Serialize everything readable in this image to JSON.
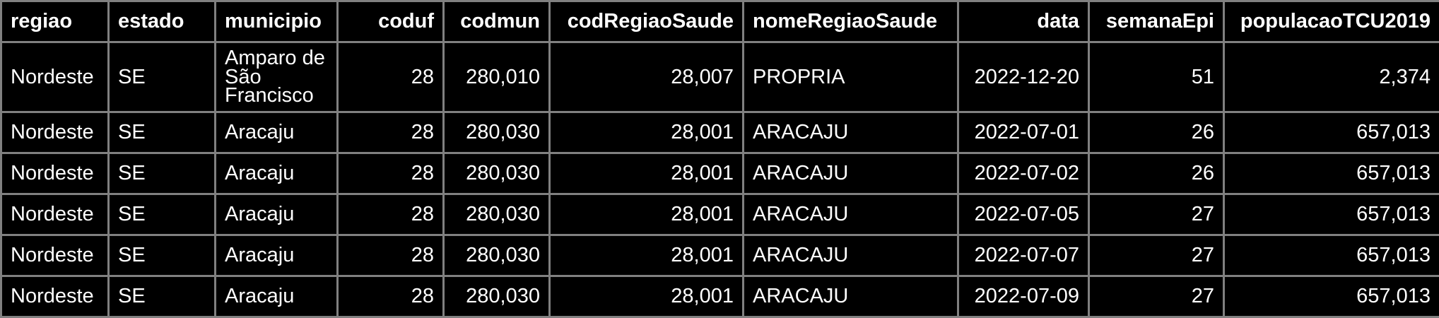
{
  "table": {
    "columns": [
      {
        "key": "regiao",
        "label": "regiao",
        "align": "left"
      },
      {
        "key": "estado",
        "label": "estado",
        "align": "left"
      },
      {
        "key": "municipio",
        "label": "municipio",
        "align": "left"
      },
      {
        "key": "coduf",
        "label": "coduf",
        "align": "right"
      },
      {
        "key": "codmun",
        "label": "codmun",
        "align": "right"
      },
      {
        "key": "codRegiaoSaude",
        "label": "codRegiaoSaude",
        "align": "right"
      },
      {
        "key": "nomeRegiaoSaude",
        "label": "nomeRegiaoSaude",
        "align": "left"
      },
      {
        "key": "data",
        "label": "data",
        "align": "right"
      },
      {
        "key": "semanaEpi",
        "label": "semanaEpi",
        "align": "right"
      },
      {
        "key": "populacaoTCU2019",
        "label": "populacaoTCU2019",
        "align": "right"
      }
    ],
    "rows": [
      {
        "regiao": "Nordeste",
        "estado": "SE",
        "municipio": "Amparo de São Francisco",
        "coduf": "28",
        "codmun": "280,010",
        "codRegiaoSaude": "28,007",
        "nomeRegiaoSaude": "PROPRIA",
        "data": "2022-12-20",
        "semanaEpi": "51",
        "populacaoTCU2019": "2,374"
      },
      {
        "regiao": "Nordeste",
        "estado": "SE",
        "municipio": "Aracaju",
        "coduf": "28",
        "codmun": "280,030",
        "codRegiaoSaude": "28,001",
        "nomeRegiaoSaude": "ARACAJU",
        "data": "2022-07-01",
        "semanaEpi": "26",
        "populacaoTCU2019": "657,013"
      },
      {
        "regiao": "Nordeste",
        "estado": "SE",
        "municipio": "Aracaju",
        "coduf": "28",
        "codmun": "280,030",
        "codRegiaoSaude": "28,001",
        "nomeRegiaoSaude": "ARACAJU",
        "data": "2022-07-02",
        "semanaEpi": "26",
        "populacaoTCU2019": "657,013"
      },
      {
        "regiao": "Nordeste",
        "estado": "SE",
        "municipio": "Aracaju",
        "coduf": "28",
        "codmun": "280,030",
        "codRegiaoSaude": "28,001",
        "nomeRegiaoSaude": "ARACAJU",
        "data": "2022-07-05",
        "semanaEpi": "27",
        "populacaoTCU2019": "657,013"
      },
      {
        "regiao": "Nordeste",
        "estado": "SE",
        "municipio": "Aracaju",
        "coduf": "28",
        "codmun": "280,030",
        "codRegiaoSaude": "28,001",
        "nomeRegiaoSaude": "ARACAJU",
        "data": "2022-07-07",
        "semanaEpi": "27",
        "populacaoTCU2019": "657,013"
      },
      {
        "regiao": "Nordeste",
        "estado": "SE",
        "municipio": "Aracaju",
        "coduf": "28",
        "codmun": "280,030",
        "codRegiaoSaude": "28,001",
        "nomeRegiaoSaude": "ARACAJU",
        "data": "2022-07-09",
        "semanaEpi": "27",
        "populacaoTCU2019": "657,013"
      }
    ]
  },
  "colors": {
    "background": "#000000",
    "text": "#ffffff",
    "grid": "#808080"
  }
}
